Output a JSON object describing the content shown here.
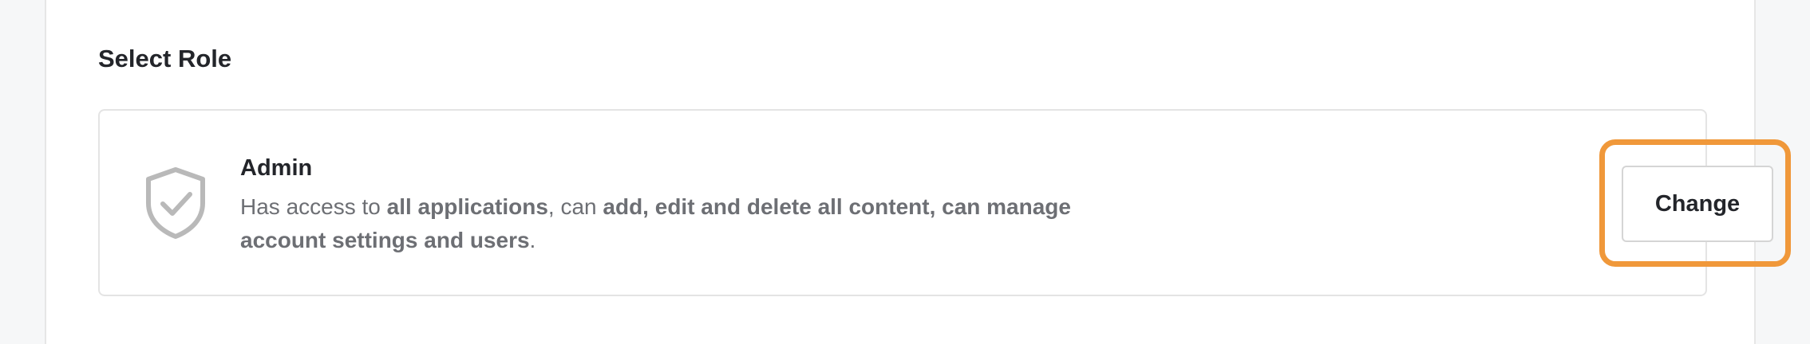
{
  "section": {
    "title": "Select Role"
  },
  "role": {
    "name": "Admin",
    "icon": "shield-check-icon",
    "description": {
      "t1": "Has access to ",
      "b1": "all applications",
      "t2": ", can ",
      "b2": "add, edit and delete all content, can manage account settings and users",
      "t3": "."
    },
    "change_label": "Change"
  },
  "colors": {
    "highlight": "#f0983a",
    "icon": "#b9b9b9",
    "text_primary": "#23252a",
    "text_secondary": "#6d6f74"
  }
}
